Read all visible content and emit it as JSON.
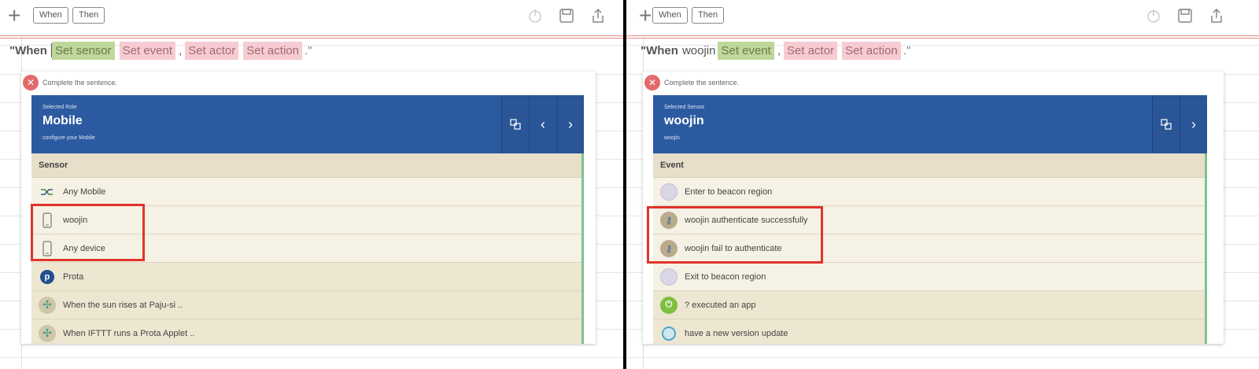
{
  "left": {
    "toolbar": {
      "when_label": "When",
      "then_label": "Then"
    },
    "sentence": {
      "when": "\"When",
      "chip_sensor": "Set sensor",
      "chip_event": "Set event",
      "chip_actor": "Set actor",
      "chip_action": "Set action",
      "comma": ",",
      "end": ".\""
    },
    "popup": {
      "hint": "Complete the sentence.",
      "role_label": "Selected Role",
      "name": "Mobile",
      "subtitle": "configure your Mobile"
    },
    "list": {
      "header": "Sensor",
      "items": [
        {
          "label": "Any Mobile",
          "icon": "shuffle-icon"
        },
        {
          "label": "woojin",
          "icon": "phone-icon"
        },
        {
          "label": "Any device",
          "icon": "phone-icon"
        },
        {
          "label": "Prota",
          "icon": "prota-logo-icon"
        },
        {
          "label": "When the sun rises at Paju-si ..",
          "icon": "ifttt-icon"
        },
        {
          "label": "When IFTTT runs a Prota Applet ..",
          "icon": "ifttt-icon"
        }
      ]
    }
  },
  "right": {
    "toolbar": {
      "when_label": "When",
      "then_label": "Then"
    },
    "sentence": {
      "when": "\"When",
      "subject": "woojin",
      "chip_event": "Set event",
      "chip_actor": "Set actor",
      "chip_action": "Set action",
      "comma": ",",
      "end": ".\""
    },
    "popup": {
      "hint": "Complete the sentence.",
      "role_label": "Selected Sensor",
      "name": "woojin",
      "subtitle": "woojin"
    },
    "list": {
      "header": "Event",
      "items": [
        {
          "label": "Enter to beacon region",
          "icon": "beacon-icon"
        },
        {
          "label": "woojin authenticate successfully",
          "icon": "key-icon"
        },
        {
          "label": "woojin fail to authenticate",
          "icon": "key-icon"
        },
        {
          "label": "Exit to beacon region",
          "icon": "beacon-icon"
        },
        {
          "label": "? executed an app",
          "icon": "power-icon"
        },
        {
          "label": "have a new version update",
          "icon": "update-icon"
        }
      ]
    }
  },
  "colors": {
    "banner": "#2c5aa0",
    "chip_green": "#bfd79a",
    "chip_pink": "#f6cbd2",
    "highlight": "#e0332a",
    "list_bg": "#f4efe0"
  }
}
